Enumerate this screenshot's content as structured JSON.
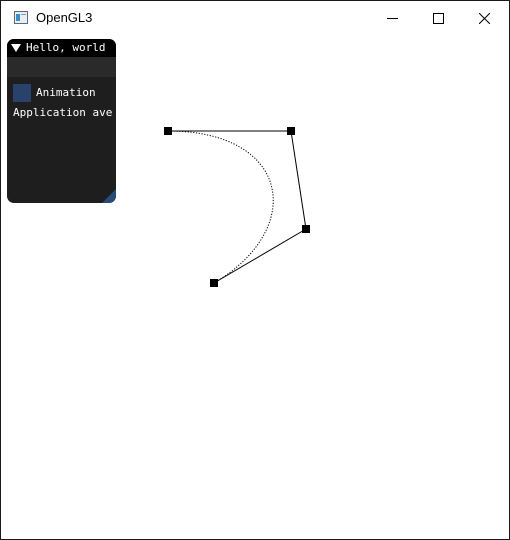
{
  "window": {
    "title": "OpenGL3",
    "app_icon": "window-app-icon",
    "controls": {
      "minimize_icon": "minimize-icon",
      "maximize_icon": "maximize-icon",
      "close_icon": "close-icon"
    }
  },
  "imgui": {
    "title": "Hello, world",
    "collapse_icon": "collapse-arrow-icon",
    "checkbox_label": "Animation",
    "checkbox_checked": false,
    "text_line": "Application ave",
    "colors": {
      "background": "#1e1e1e",
      "title_bg": "#000000",
      "checkbox": "#29426b",
      "resize_grip": "#2a4a78"
    }
  },
  "canvas": {
    "background": "#ffffff",
    "stroke_color": "#000000",
    "control_points_count": 4
  }
}
